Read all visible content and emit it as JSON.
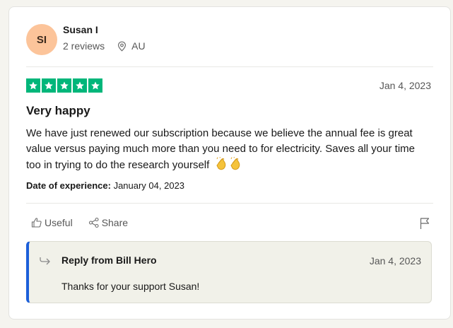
{
  "consumer": {
    "initials": "SI",
    "name": "Susan I",
    "reviews_count": "2 reviews",
    "country": "AU",
    "avatar_color": "#fcc49a"
  },
  "review": {
    "rating": 5,
    "rating_max": 5,
    "star_color": "#00b67a",
    "date": "Jan 4, 2023",
    "title": "Very happy",
    "body": "We have just renewed our subscription because we believe the annual fee is great value versus paying much more than you need to for electricity. Saves all your time too in trying to do the research yourself",
    "emoji": "clapping-hands-icon",
    "experience_label": "Date of experience:",
    "experience_date": "January 04, 2023"
  },
  "actions": {
    "useful_label": "Useful",
    "share_label": "Share"
  },
  "reply": {
    "from": "Reply from Bill Hero",
    "date": "Jan 4, 2023",
    "text": "Thanks for your support Susan!",
    "accent_color": "#1c5fd9"
  }
}
